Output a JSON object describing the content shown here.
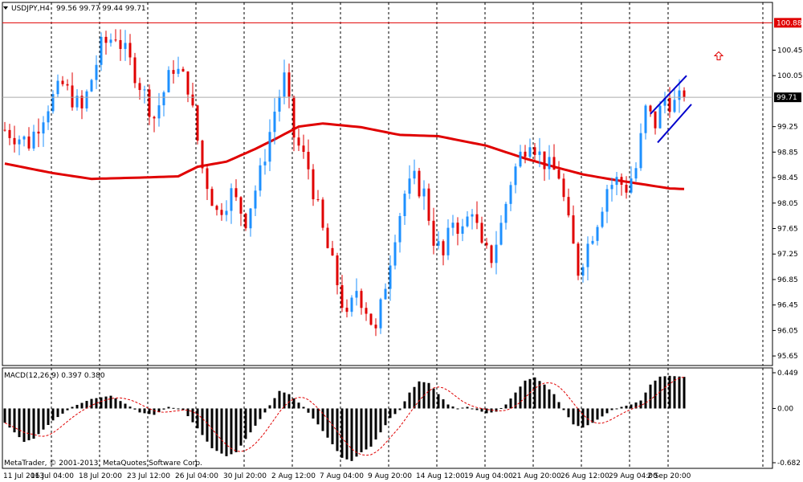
{
  "header": {
    "symbol_timeframe": "USDJPY,H4",
    "ohlc": "99.56 99.77 99.44 99.71",
    "dropdown_icon": "triangle-down-icon"
  },
  "macd": {
    "title": "MACD(12,26,9) 0.397 0.380",
    "ticks": [
      {
        "value": 0.449,
        "label": "0.449"
      },
      {
        "value": 0.0,
        "label": "0.00"
      },
      {
        "value": -0.682,
        "label": "-0.682"
      }
    ],
    "range": [
      -0.682,
      0.449
    ]
  },
  "copyright": "MetaTrader, © 2001-2013, MetaQuotes Software Corp.",
  "price_labels": {
    "resistance": "100.88",
    "current": "99.71"
  },
  "colors": {
    "bull": "#1E90FF",
    "bear": "#E00000",
    "ma": "#E00000",
    "channel": "#0000CC",
    "resistance": "#E00000",
    "signal": "#E00000",
    "histogram": "#000000",
    "arrow": "#E00000"
  },
  "chart_data": {
    "type": "candlestick",
    "symbol": "USDJPY",
    "timeframe": "H4",
    "x_labels": [
      "11 Jul 2013",
      "16 Jul 04:00",
      "18 Jul 20:00",
      "23 Jul 12:00",
      "26 Jul 04:00",
      "30 Jul 20:00",
      "2 Aug 12:00",
      "7 Aug 04:00",
      "9 Aug 20:00",
      "14 Aug 12:00",
      "19 Aug 04:00",
      "21 Aug 20:00",
      "26 Aug 12:00",
      "29 Aug 04:00",
      "2 Sep 20:00"
    ],
    "y_ticks": [
      100.45,
      100.05,
      99.25,
      98.85,
      98.45,
      98.05,
      97.65,
      97.25,
      96.85,
      96.45,
      96.05,
      95.65
    ],
    "y_range": [
      95.5,
      101.2
    ],
    "resistance_level": 100.88,
    "current_price": 99.71,
    "price_waypoints": [
      [
        0,
        99.2
      ],
      [
        5,
        99.0
      ],
      [
        9,
        99.6
      ],
      [
        12,
        99.9
      ],
      [
        16,
        99.5
      ],
      [
        20,
        100.5
      ],
      [
        23,
        100.7
      ],
      [
        27,
        100.1
      ],
      [
        31,
        99.4
      ],
      [
        35,
        100.2
      ],
      [
        38,
        99.9
      ],
      [
        41,
        98.6
      ],
      [
        44,
        97.9
      ],
      [
        47,
        98.2
      ],
      [
        50,
        97.8
      ],
      [
        53,
        98.5
      ],
      [
        56,
        99.5
      ],
      [
        58,
        100.0
      ],
      [
        60,
        99.1
      ],
      [
        63,
        98.6
      ],
      [
        66,
        97.6
      ],
      [
        69,
        96.8
      ],
      [
        71,
        96.2
      ],
      [
        73,
        96.7
      ],
      [
        75,
        96.4
      ],
      [
        77,
        96.0
      ],
      [
        79,
        96.8
      ],
      [
        81,
        97.6
      ],
      [
        83,
        98.2
      ],
      [
        85,
        98.4
      ],
      [
        87,
        98.2
      ],
      [
        89,
        97.5
      ],
      [
        91,
        97.2
      ],
      [
        93,
        97.8
      ],
      [
        95,
        97.6
      ],
      [
        97,
        98.0
      ],
      [
        99,
        97.3
      ],
      [
        101,
        97.2
      ],
      [
        103,
        97.7
      ],
      [
        105,
        98.4
      ],
      [
        107,
        98.8
      ],
      [
        109,
        99.1
      ],
      [
        111,
        98.8
      ],
      [
        113,
        98.6
      ],
      [
        115,
        98.5
      ],
      [
        117,
        97.7
      ],
      [
        119,
        97.0
      ],
      [
        121,
        97.4
      ],
      [
        123,
        97.8
      ],
      [
        125,
        98.3
      ],
      [
        127,
        98.4
      ],
      [
        129,
        98.3
      ],
      [
        131,
        98.6
      ],
      [
        133,
        99.5
      ],
      [
        135,
        99.3
      ],
      [
        137,
        99.7
      ],
      [
        139,
        99.6
      ],
      [
        141,
        99.71
      ]
    ],
    "ma_waypoints": [
      [
        0,
        98.67
      ],
      [
        10,
        98.52
      ],
      [
        18,
        98.43
      ],
      [
        28,
        98.45
      ],
      [
        36,
        98.47
      ],
      [
        40,
        98.62
      ],
      [
        46,
        98.7
      ],
      [
        52,
        98.9
      ],
      [
        56,
        99.05
      ],
      [
        61,
        99.25
      ],
      [
        66,
        99.3
      ],
      [
        74,
        99.24
      ],
      [
        82,
        99.12
      ],
      [
        90,
        99.1
      ],
      [
        100,
        98.95
      ],
      [
        108,
        98.75
      ],
      [
        114,
        98.62
      ],
      [
        120,
        98.5
      ],
      [
        126,
        98.42
      ],
      [
        132,
        98.35
      ],
      [
        138,
        98.28
      ],
      [
        141,
        98.27
      ]
    ],
    "channel_upper": [
      [
        99.45,
        134
      ],
      [
        100.05,
        141.5
      ]
    ],
    "channel_lower": [
      [
        99.0,
        135.5
      ],
      [
        99.6,
        142.5
      ]
    ],
    "macd_main_waypoints": [
      [
        0,
        -0.18
      ],
      [
        4,
        -0.42
      ],
      [
        6,
        -0.38
      ],
      [
        10,
        -0.15
      ],
      [
        14,
        0.02
      ],
      [
        18,
        0.12
      ],
      [
        22,
        0.16
      ],
      [
        25,
        0.06
      ],
      [
        28,
        -0.05
      ],
      [
        31,
        -0.08
      ],
      [
        34,
        0.02
      ],
      [
        37,
        -0.02
      ],
      [
        40,
        -0.25
      ],
      [
        43,
        -0.5
      ],
      [
        46,
        -0.6
      ],
      [
        48,
        -0.55
      ],
      [
        51,
        -0.3
      ],
      [
        54,
        -0.05
      ],
      [
        57,
        0.22
      ],
      [
        59,
        0.18
      ],
      [
        62,
        0.02
      ],
      [
        65,
        -0.2
      ],
      [
        68,
        -0.45
      ],
      [
        70,
        -0.62
      ],
      [
        72,
        -0.66
      ],
      [
        74,
        -0.55
      ],
      [
        76,
        -0.48
      ],
      [
        78,
        -0.3
      ],
      [
        80,
        -0.12
      ],
      [
        82,
        -0.02
      ],
      [
        84,
        0.2
      ],
      [
        86,
        0.34
      ],
      [
        88,
        0.32
      ],
      [
        90,
        0.18
      ],
      [
        92,
        0.05
      ],
      [
        94,
        0.0
      ],
      [
        96,
        0.02
      ],
      [
        98,
        -0.02
      ],
      [
        100,
        -0.06
      ],
      [
        102,
        -0.04
      ],
      [
        104,
        0.05
      ],
      [
        106,
        0.2
      ],
      [
        108,
        0.35
      ],
      [
        110,
        0.39
      ],
      [
        112,
        0.3
      ],
      [
        114,
        0.18
      ],
      [
        116,
        -0.02
      ],
      [
        118,
        -0.2
      ],
      [
        120,
        -0.24
      ],
      [
        122,
        -0.18
      ],
      [
        124,
        -0.1
      ],
      [
        126,
        -0.02
      ],
      [
        128,
        0.02
      ],
      [
        130,
        0.05
      ],
      [
        132,
        0.1
      ],
      [
        134,
        0.3
      ],
      [
        136,
        0.4
      ],
      [
        138,
        0.41
      ],
      [
        141,
        0.397
      ]
    ]
  }
}
